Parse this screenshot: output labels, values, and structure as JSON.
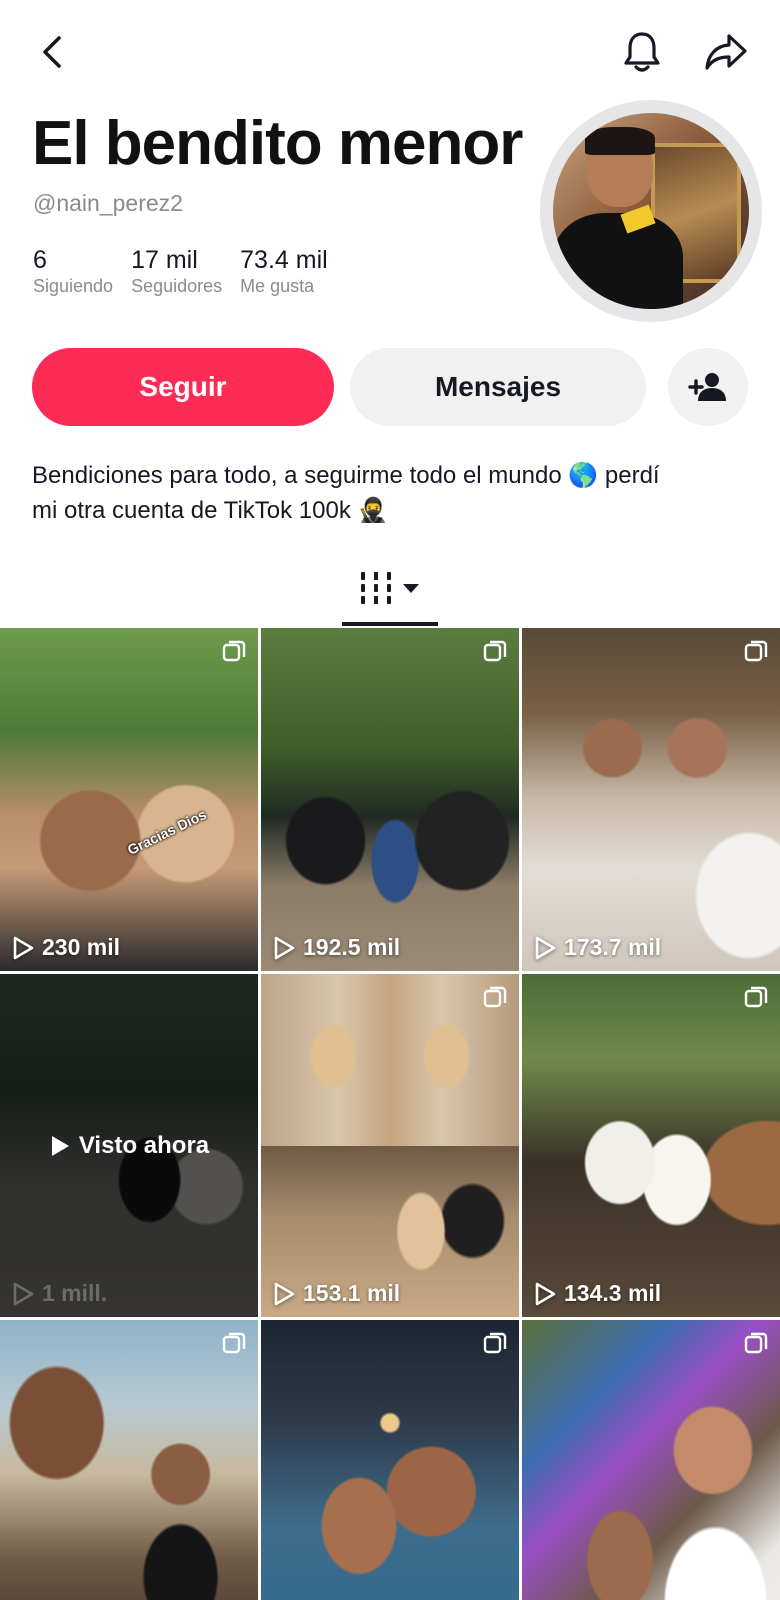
{
  "header": {
    "back_icon": "chevron-left-icon",
    "bell_icon": "bell-icon",
    "share_icon": "share-arrow-icon"
  },
  "profile": {
    "name": "El bendito menor",
    "handle": "@nain_perez2",
    "stats": [
      {
        "value": "6",
        "label": "Siguiendo"
      },
      {
        "value": "17 mil",
        "label": "Seguidores"
      },
      {
        "value": "73.4 mil",
        "label": "Me gusta"
      }
    ],
    "bio_line1": "Bendiciones para todo, a seguirme todo el mundo 🌎 perdí",
    "bio_line2": "mi otra cuenta de TikTok 100k 🥷"
  },
  "actions": {
    "follow_label": "Seguir",
    "message_label": "Mensajes",
    "add_friend_icon": "add-user-icon",
    "follow_color": "#fe2c55"
  },
  "tabs": {
    "grid_icon": "grid-columns-icon",
    "dropdown_icon": "caret-down-icon"
  },
  "videos": [
    {
      "views": "230 mil",
      "sticker": "Gracias Dios",
      "multi": true
    },
    {
      "views": "192.5 mil",
      "multi": true
    },
    {
      "views": "173.7 mil",
      "multi": true
    },
    {
      "views": "1 mill.",
      "watched_label": "Visto ahora"
    },
    {
      "views": "153.1 mil",
      "multi": true
    },
    {
      "views": "134.3 mil",
      "multi": true
    },
    {
      "views": "",
      "multi": true
    },
    {
      "views": "",
      "multi": true
    },
    {
      "views": "",
      "multi": true
    }
  ]
}
